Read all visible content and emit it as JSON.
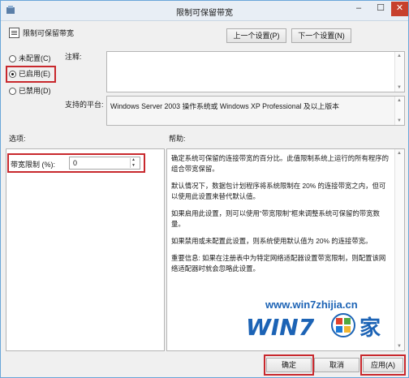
{
  "window": {
    "title": "限制可保留带宽",
    "min_glyph": "–",
    "max_glyph": "☐",
    "close_glyph": "✕"
  },
  "header": {
    "setting_name": "限制可保留带宽",
    "prev_button": "上一个设置(P)",
    "next_button": "下一个设置(N)"
  },
  "state": {
    "options": [
      {
        "label": "未配置(C)",
        "selected": false
      },
      {
        "label": "已启用(E)",
        "selected": true
      },
      {
        "label": "已禁用(D)",
        "selected": false
      }
    ]
  },
  "comment": {
    "label": "注释:",
    "value": ""
  },
  "platform": {
    "label": "支持的平台:",
    "value": "Windows Server 2003 操作系统或 Windows XP Professional 及以上版本"
  },
  "options_section": {
    "label": "选项:",
    "bandwidth_label": "带宽限制 (%):",
    "bandwidth_value": "0"
  },
  "help_section": {
    "label": "帮助:",
    "paragraphs": [
      "确定系统可保留的连接带宽的百分比。此值限制系统上运行的所有程序的组合带宽保留。",
      "默认情况下，数据包计划程序将系统限制在 20% 的连接带宽之内，但可以使用此设置来替代默认值。",
      "如果启用此设置，则可以使用“带宽限制”框来调整系统可保留的带宽数量。",
      "如果禁用或未配置此设置，则系统使用默认值为 20% 的连接带宽。",
      "重要信息: 如果在注册表中为特定网络适配器设置带宽限制，则配置该网络适配器时就会忽略此设置。"
    ]
  },
  "footer": {
    "ok": "确定",
    "cancel": "取消",
    "apply": "应用(A)"
  },
  "watermark": {
    "url": "www.win7zhijia.cn",
    "logo_text": "WIN7",
    "logo_suffix": "家"
  },
  "colors": {
    "highlight": "#c8282d",
    "close_button": "#c7402d",
    "watermark_blue": "#1c63b5"
  }
}
